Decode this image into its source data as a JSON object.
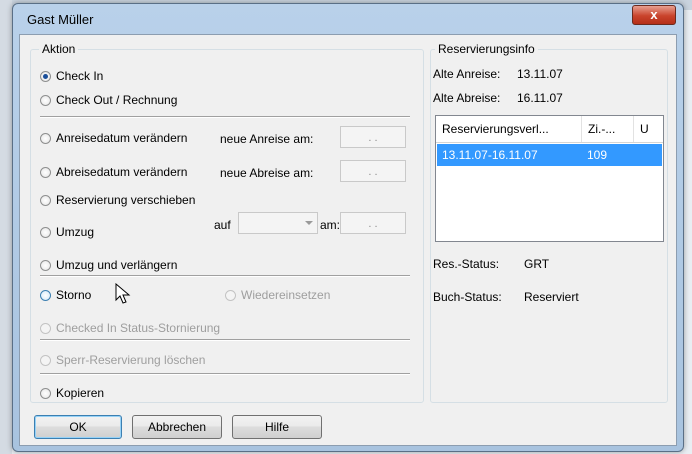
{
  "window": {
    "title": "Gast Müller",
    "close_label": "x"
  },
  "aktion": {
    "legend": "Aktion",
    "check_in": "Check In",
    "check_out": "Check Out / Rechnung",
    "anreise_change": "Anreisedatum verändern",
    "neue_anreise_label": "neue Anreise am:",
    "neue_anreise_value": ". .",
    "abreise_change": "Abreisedatum verändern",
    "neue_abreise_label": "neue Abreise am:",
    "neue_abreise_value": ". .",
    "verschieben": "Reservierung verschieben",
    "umzug": "Umzug",
    "umzug_auf_label": "auf",
    "umzug_am_label": "am:",
    "umzug_am_value": ". .",
    "umzug_verlaengern": "Umzug und verlängern",
    "storno": "Storno",
    "wiedereinsetzen": "Wiedereinsetzen",
    "checked_in_storno": "Checked In Status-Stornierung",
    "sperr_loeschen": "Sperr-Reservierung löschen",
    "kopieren": "Kopieren",
    "selected": "Check In"
  },
  "reservierungsinfo": {
    "legend": "Reservierungsinfo",
    "alte_anreise_label": "Alte Anreise:",
    "alte_anreise_value": "13.11.07",
    "alte_abreise_label": "Alte Abreise:",
    "alte_abreise_value": "16.11.07",
    "columns": [
      "Reservierungsverl...",
      "Zi.-...",
      "U"
    ],
    "rows": [
      {
        "period": "13.11.07-16.11.07",
        "zimmer": "109",
        "u": ""
      }
    ],
    "res_status_label": "Res.-Status:",
    "res_status_value": "GRT",
    "buch_status_label": "Buch-Status:",
    "buch_status_value": "Reserviert"
  },
  "buttons": {
    "ok": "OK",
    "abbrechen": "Abbrechen",
    "hilfe": "Hilfe"
  },
  "colors": {
    "selection": "#3399ff",
    "titlebar": "#b9d1ea",
    "close": "#c9432b"
  }
}
